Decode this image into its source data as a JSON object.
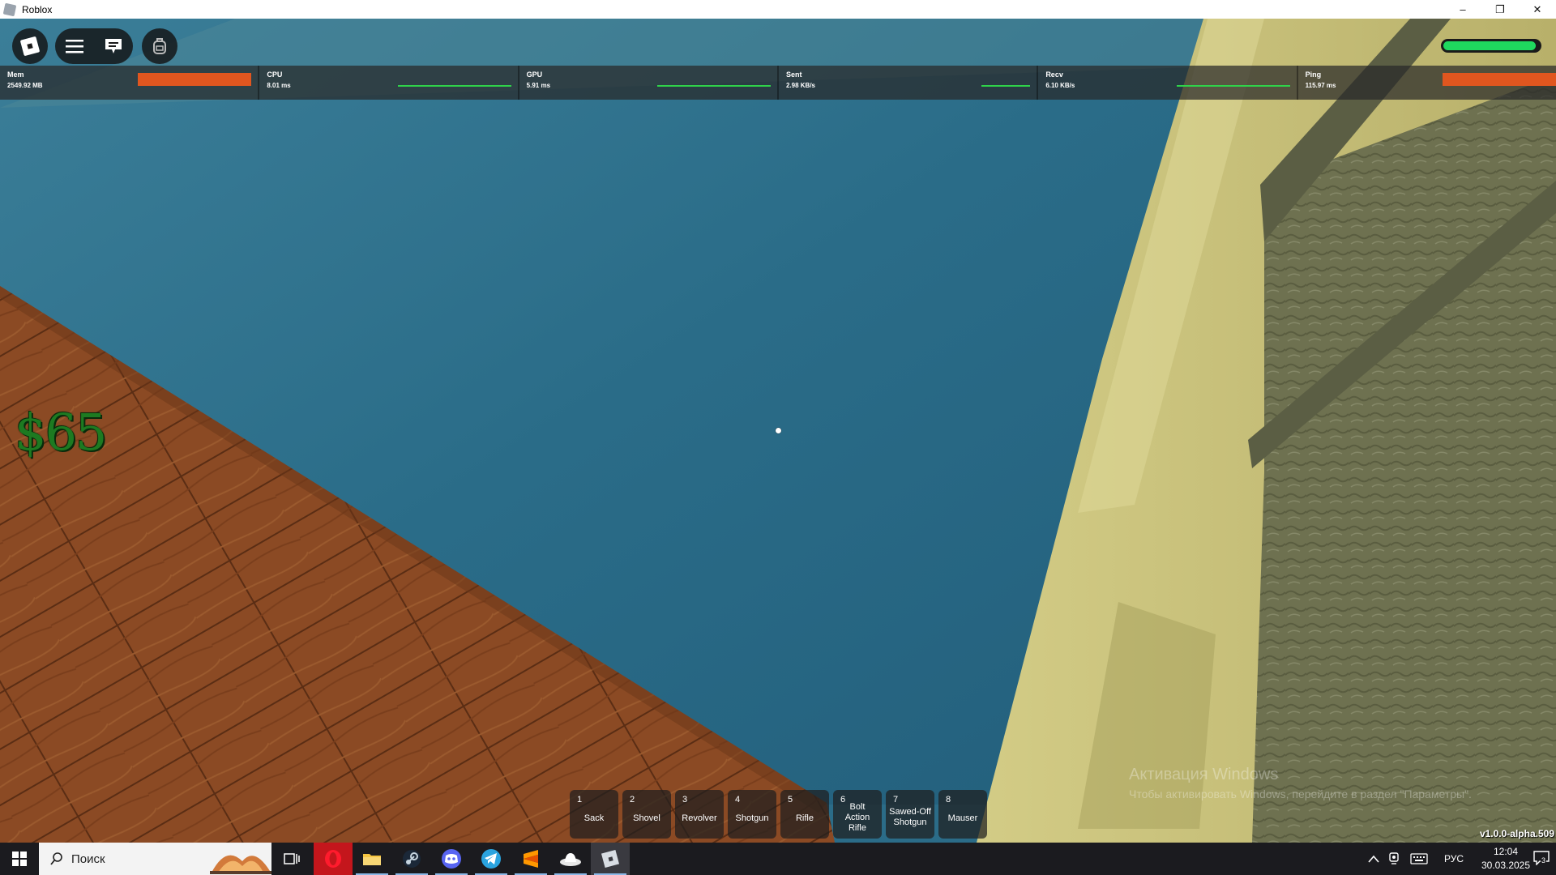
{
  "window": {
    "title": "Roblox",
    "controls": [
      "–",
      "❐",
      "✕"
    ]
  },
  "hud": {
    "health_fraction": 0.97,
    "money": "$65",
    "version": "v1.0.0-alpha.509"
  },
  "stats": [
    {
      "name": "Mem",
      "value": "2549.92 MB",
      "graph": "bar"
    },
    {
      "name": "CPU",
      "value": "8.01 ms",
      "graph": "line"
    },
    {
      "name": "GPU",
      "value": "5.91 ms",
      "graph": "line"
    },
    {
      "name": "Sent",
      "value": "2.98 KB/s",
      "graph": "line"
    },
    {
      "name": "Recv",
      "value": "6.10 KB/s",
      "graph": "line"
    },
    {
      "name": "Ping",
      "value": "115.97 ms",
      "graph": "bar"
    }
  ],
  "hotbar": [
    {
      "num": "1",
      "name": "Sack"
    },
    {
      "num": "2",
      "name": "Shovel"
    },
    {
      "num": "3",
      "name": "Revolver"
    },
    {
      "num": "4",
      "name": "Shotgun"
    },
    {
      "num": "5",
      "name": "Rifle"
    },
    {
      "num": "6",
      "name": "Bolt Action Rifle"
    },
    {
      "num": "7",
      "name": "Sawed-Off Shotgun"
    },
    {
      "num": "8",
      "name": "Mauser"
    }
  ],
  "watermark": {
    "line1": "Активация Windows",
    "line2": "Чтобы активировать Windows, перейдите в раздел \"Параметры\"."
  },
  "taskbar": {
    "search_placeholder": "Поиск",
    "apps": [
      "task-view",
      "opera",
      "file-explorer",
      "steam",
      "discord",
      "telegram",
      "sublime-text",
      "hat-app",
      "roblox"
    ],
    "language": "РУС",
    "time": "12:04",
    "date": "30.03.2025",
    "notification_count": "3"
  },
  "colors": {
    "water": "#2b6c88",
    "wood": "#8b4a24",
    "wall": "#c7c07a",
    "stone": "#6e7150",
    "stat_bar": "#e0561f",
    "stat_line": "#2fd34a",
    "health": "#1fd85e",
    "money": "#1d7a21"
  }
}
